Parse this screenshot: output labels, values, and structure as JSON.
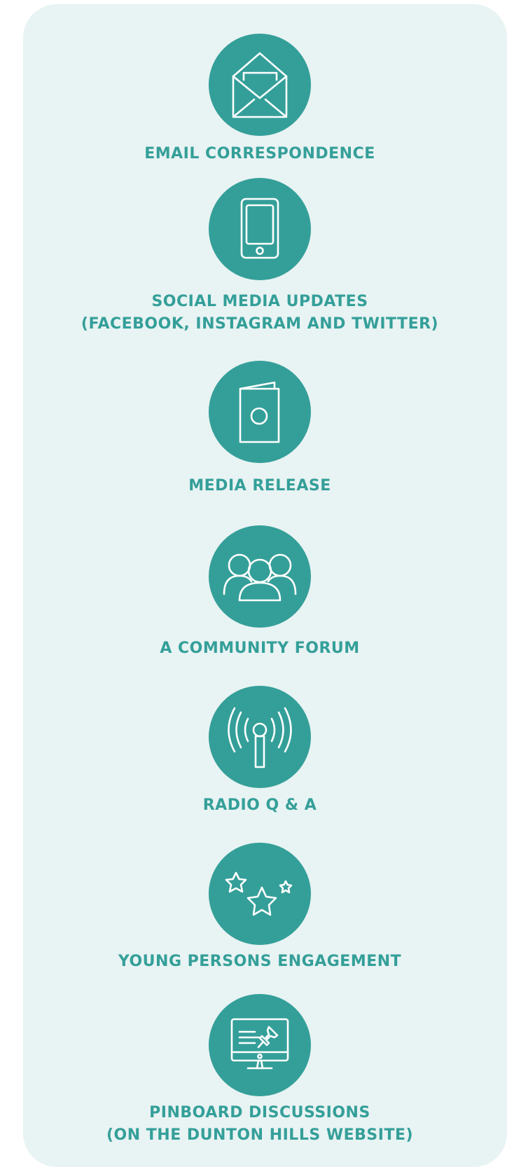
{
  "colors": {
    "accent": "#349f99",
    "panel_background": "#e8f3f3",
    "icon_stroke": "#ffffff"
  },
  "items": [
    {
      "icon": "envelope-icon",
      "lines": [
        "EMAIL CORRESPONDENCE"
      ]
    },
    {
      "icon": "smartphone-icon",
      "lines": [
        "SOCIAL MEDIA UPDATES",
        "(FACEBOOK, INSTAGRAM AND TWITTER)"
      ]
    },
    {
      "icon": "document-icon",
      "lines": [
        "MEDIA RELEASE"
      ]
    },
    {
      "icon": "people-group-icon",
      "lines": [
        "A COMMUNITY FORUM"
      ]
    },
    {
      "icon": "radio-antenna-icon",
      "lines": [
        "RADIO Q & A"
      ]
    },
    {
      "icon": "stars-icon",
      "lines": [
        "YOUNG PERSONS ENGAGEMENT"
      ]
    },
    {
      "icon": "monitor-pin-icon",
      "lines": [
        "PINBOARD DISCUSSIONS",
        "(ON THE DUNTON HILLS WEBSITE)"
      ]
    }
  ]
}
